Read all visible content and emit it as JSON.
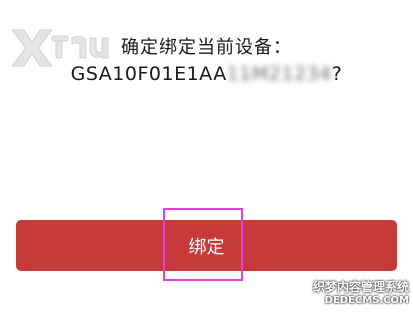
{
  "prompt": {
    "line1": "确定绑定当前设备：",
    "device_prefix": "GSA10F01E1AA",
    "device_hidden": "11M21234",
    "suffix": "?"
  },
  "button": {
    "label": "绑定"
  },
  "watermark": {
    "line1": "织梦内容管理系统",
    "line2": "DEDECMS.COM"
  },
  "colors": {
    "button_bg": "#c63a3a",
    "highlight": "#e040e0"
  }
}
